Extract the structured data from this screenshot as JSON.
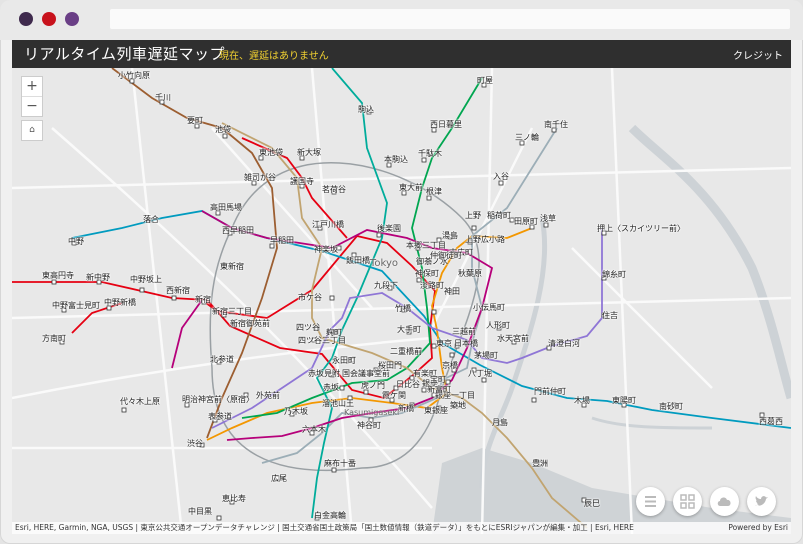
{
  "window": {
    "dots": [
      "#3f2a4d",
      "#c8121c",
      "#6a3f86"
    ]
  },
  "header": {
    "title": "リアルタイム列車遅延マップ",
    "status": "現在、遅延はありません",
    "credit": "クレジット"
  },
  "map": {
    "zoom_in": "+",
    "zoom_out": "−",
    "city_label": "Tokyo",
    "district_label": "Kasumigaseki",
    "stations": [
      "小竹向原",
      "千川",
      "要町",
      "池袋",
      "東池袋",
      "新大塚",
      "雑司が谷",
      "護国寺",
      "茗荷谷",
      "高田馬場",
      "西早稲田",
      "早稲田",
      "江戸川橋",
      "後楽園",
      "落合",
      "中野",
      "東高円寺",
      "新中野",
      "中野坂上",
      "西新宿",
      "新宿",
      "新宿三丁目",
      "新宿御苑前",
      "東新宿",
      "中野富士見町",
      "中野新橋",
      "方南町",
      "北参道",
      "明治神宮前〈原宿〉",
      "代々木上原",
      "表参道",
      "外苑前",
      "渋谷",
      "乃木坂",
      "六本木",
      "広尾",
      "恵比寿",
      "中目黒",
      "麻布十番",
      "白金高輪",
      "駒込",
      "西日暮里",
      "本駒込",
      "千駄木",
      "東大前",
      "根津",
      "町屋",
      "三ノ輪",
      "南千住",
      "入谷",
      "上野",
      "稲荷町",
      "田原町",
      "浅草",
      "押上〈スカイツリー前〉",
      "湯島",
      "上野広小路",
      "神田",
      "本郷三丁目",
      "御茶ノ水",
      "末広町",
      "秋葉原",
      "小伝馬町",
      "人形町",
      "水天宮前",
      "清澄白河",
      "住吉",
      "錦糸町",
      "九段下",
      "竹橋",
      "神保町",
      "市ケ谷",
      "飯田橋",
      "神楽坂",
      "四ツ谷",
      "四ツ谷三丁目",
      "麹町",
      "永田町",
      "赤坂見附",
      "赤坂",
      "溜池山王",
      "国会議事堂前",
      "虎ノ門",
      "桜田門",
      "霞ケ関",
      "日比谷",
      "銀座",
      "銀座一丁目",
      "有楽町",
      "東京",
      "大手町",
      "二重橋前",
      "淡路町",
      "日本橋",
      "三越前",
      "茅場町",
      "八丁堀",
      "京橋",
      "宝町",
      "新富町",
      "築地",
      "東銀座",
      "新橋",
      "門前仲町",
      "木場",
      "東陽町",
      "南砂町",
      "西葛西",
      "月島",
      "豊洲",
      "辰巳",
      "神谷町",
      "仲御徒町"
    ],
    "attribution": "Esri, HERE, Garmin, NGA, USGS | 東京公共交通オープンデータチャレンジ | 国土交通省国土政策局「国土数値情報（鉄道データ）」をもとにESRIジャパンが編集・加工 | Esri, HERE",
    "powered": "Powered by Esri",
    "line_colors": {
      "marunouchi": "#e60012",
      "ginza": "#f39700",
      "hibiya": "#9caeb7",
      "tozai": "#009bbf",
      "chiyoda": "#00a650",
      "yurakucho": "#c1a470",
      "hanzomon": "#8f76d6",
      "namboku": "#00ac9b",
      "fukutoshin": "#9c5e31",
      "oedo": "#b6007a"
    }
  },
  "buttons": {
    "list": "list-icon",
    "qr": "qr-icon",
    "cloud": "cloud-icon",
    "twitter": "twitter-icon"
  }
}
